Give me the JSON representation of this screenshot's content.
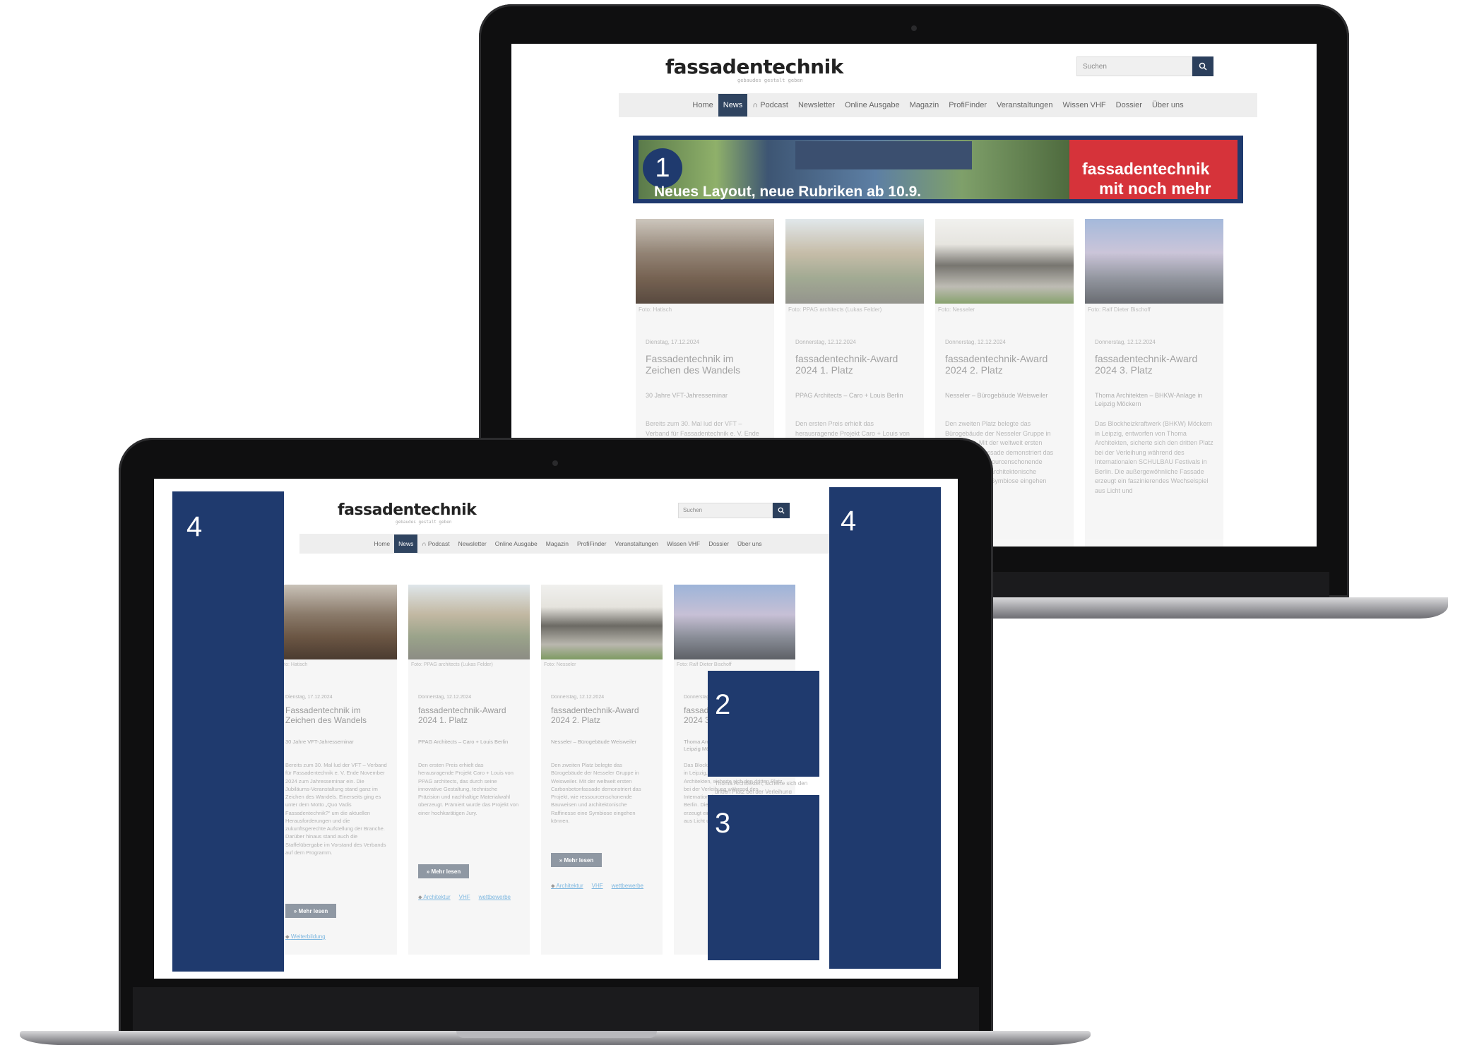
{
  "site": {
    "logo": "fassadentechnik",
    "tagline": "gebaudes gestalt geben",
    "search_placeholder": "Suchen",
    "nav": [
      {
        "label": "Home",
        "active": false
      },
      {
        "label": "News",
        "active": true
      },
      {
        "label": "∩ Podcast",
        "active": false
      },
      {
        "label": "Newsletter",
        "active": false
      },
      {
        "label": "Online Ausgabe",
        "active": false
      },
      {
        "label": "Magazin",
        "active": false
      },
      {
        "label": "ProfiFinder",
        "active": false
      },
      {
        "label": "Veranstaltungen",
        "active": false
      },
      {
        "label": "Wissen VHF",
        "active": false
      },
      {
        "label": "Dossier",
        "active": false
      },
      {
        "label": "Über uns",
        "active": false
      }
    ]
  },
  "banner": {
    "number": "1",
    "headline": "Neues Layout, neue Rubriken ab 10.9.",
    "brand_line1": "fassadentechnik",
    "brand_line2": "mit noch mehr"
  },
  "cards": [
    {
      "caption": "Foto: Hatisch",
      "date": "Dienstag, 17.12.2024",
      "title": "Fassadentechnik im Zeichen des Wandels",
      "sub": "30 Jahre VFT-Jahresseminar",
      "body": "Bereits zum 30. Mal lud der VFT – Verband für Fassadentechnik e. V. Ende November 2024 zum Jahresseminar ein. Die Jubiläums-Veranstaltung stand ganz im Zeichen des Wandels. Einerseits ging es unter dem Motto „Quo Vadis Fassadentechnik?“ um die aktuellen Herausforderungen und die zukunftsgerechte Aufstellung der Branche. Darüber hinaus stand auch die Staffelübergabe im Vorstand des Verbands auf dem Programm.",
      "more": "» Mehr lesen",
      "tags": [
        "Weiterbildung"
      ]
    },
    {
      "caption": "Foto: PPAG architects (Lukas Felder)",
      "date": "Donnerstag, 12.12.2024",
      "title": "fassadentechnik-Award 2024 1. Platz",
      "sub": "PPAG Architects – Caro + Louis Berlin",
      "body": "Den ersten Preis erhielt das herausragende Projekt Caro + Louis von PPAG architects, das durch seine innovative Gestaltung, technische Präzision und nachhaltige Materialwahl überzeugt. Prämiert wurde das Projekt von einer hochkarätigen Jury.",
      "more": "» Mehr lesen",
      "tags": [
        "Architektur",
        "VHF",
        "wettbewerbe"
      ]
    },
    {
      "caption": "Foto: Nesseler",
      "date": "Donnerstag, 12.12.2024",
      "title": "fassadentechnik-Award 2024 2. Platz",
      "sub": "Nesseler – Bürogebäude Weisweiler",
      "body": "Den zweiten Platz belegte das Bürogebäude der Nesseler Gruppe in Weisweiler. Mit der weltweit ersten Carbonbetonfassade demonstriert das Projekt, wie ressourcenschonende Bauweisen und architektonische Raffinesse eine Symbiose eingehen können.",
      "more": "» Mehr lesen",
      "tags": [
        "Architektur",
        "VHF",
        "wettbewerbe"
      ]
    },
    {
      "caption": "Foto: Ralf Dieter Bischoff",
      "date": "Donnerstag, 12.12.2024",
      "title": "fassadentechnik-Award 2024 3. Platz",
      "sub": "Thoma Architekten – BHKW-Anlage in Leipzig Möckern",
      "body": "Das Blockheizkraftwerk (BHKW) Möckern in Leipzig, entworfen von Thoma Architekten, sicherte sich den dritten Platz bei der Verleihung während des Internationalen SCHULBAU Festivals in Berlin. Die außergewöhnliche Fassade erzeugt ein faszinierendes Wechselspiel aus Licht und",
      "snippet_front": "Thoma Architekten, sicherte sich den dritten Platz bei der Verleihung"
    }
  ],
  "overlays": {
    "left_skyscraper": "4",
    "right_skyscraper": "4",
    "ad_box_2": "2",
    "ad_box_3": "3"
  },
  "colors": {
    "overlay_blue": "#1f3a6e",
    "nav_active": "#2f4460",
    "banner_red": "#d6333a"
  }
}
